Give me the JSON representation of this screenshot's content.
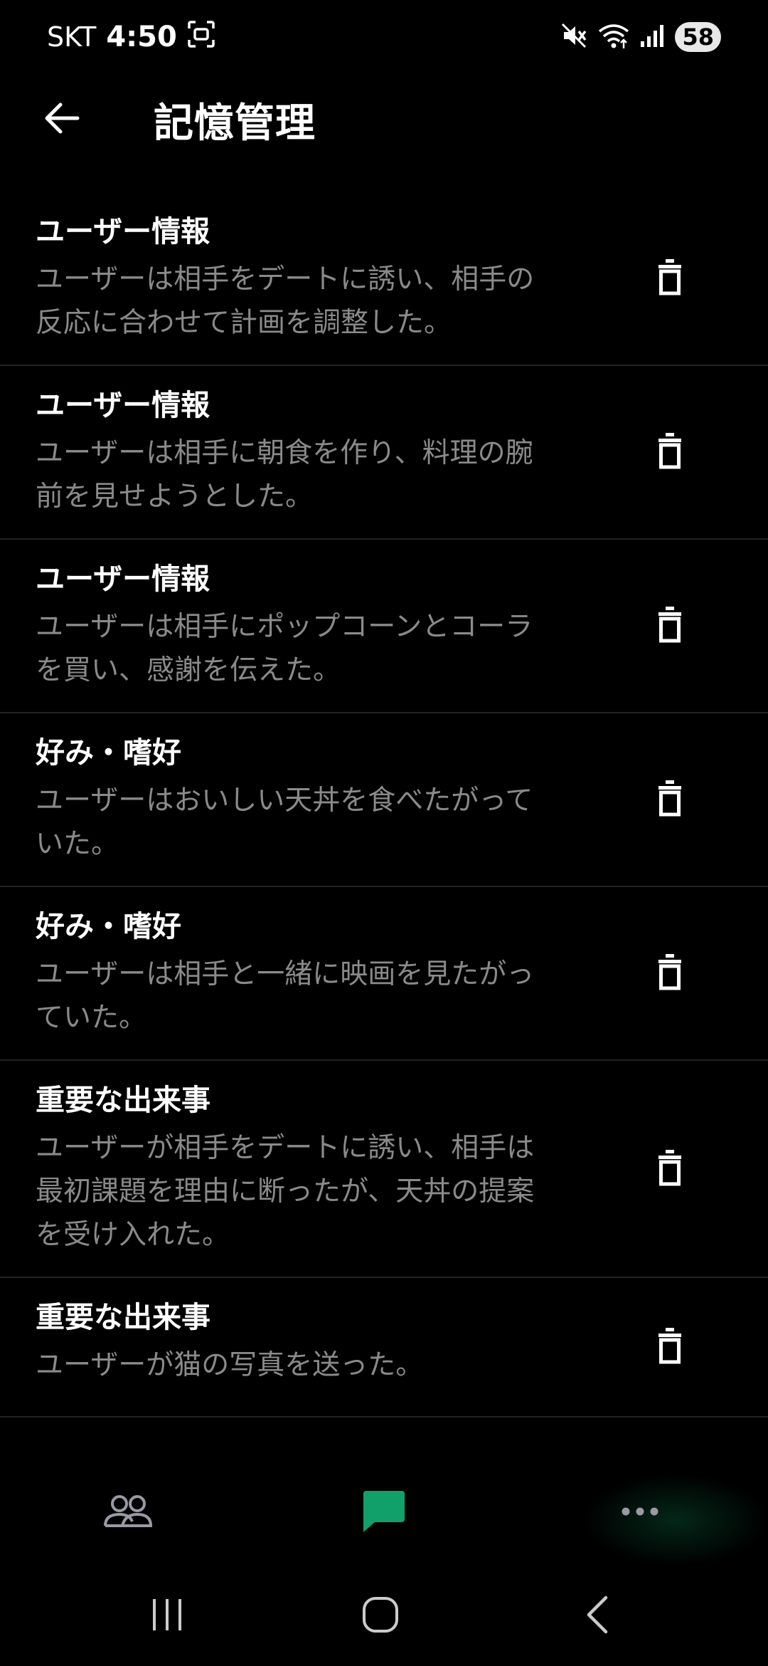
{
  "status_bar": {
    "carrier": "SKT",
    "time": "4:50",
    "battery": "58",
    "icons": [
      "face-scan-icon",
      "mute-icon",
      "wifi-icon",
      "signal-icon"
    ]
  },
  "header": {
    "title": "記憶管理",
    "back_icon": "arrow-left-icon"
  },
  "memories": [
    {
      "category": "ユーザー情報",
      "lines": [
        "ユーザーは相手をデートに誘い、相手の",
        "反応に合わせて計画を調整した。"
      ]
    },
    {
      "category": "ユーザー情報",
      "lines": [
        "ユーザーは相手に朝食を作り、料理の腕",
        "前を見せようとした。"
      ]
    },
    {
      "category": "ユーザー情報",
      "lines": [
        "ユーザーは相手にポップコーンとコーラ",
        "を買い、感謝を伝えた。"
      ]
    },
    {
      "category": "好み・嗜好",
      "lines": [
        "ユーザーはおいしい天丼を食べたがって",
        "いた。"
      ]
    },
    {
      "category": "好み・嗜好",
      "lines": [
        "ユーザーは相手と一緒に映画を見たがっ",
        "ていた。"
      ]
    },
    {
      "category": "重要な出来事",
      "lines": [
        "ユーザーが相手をデートに誘い、相手は",
        "最初課題を理由に断ったが、天丼の提案",
        "を受け入れた。"
      ]
    },
    {
      "category": "重要な出来事",
      "lines": [
        "ユーザーが猫の写真を送った。"
      ]
    }
  ],
  "bottom_nav": {
    "items": [
      "people-icon",
      "chat-icon",
      "more-icon"
    ],
    "active": "chat-icon",
    "accent": "#12a06a"
  },
  "system_nav": [
    "recents-icon",
    "home-icon",
    "back-icon"
  ]
}
